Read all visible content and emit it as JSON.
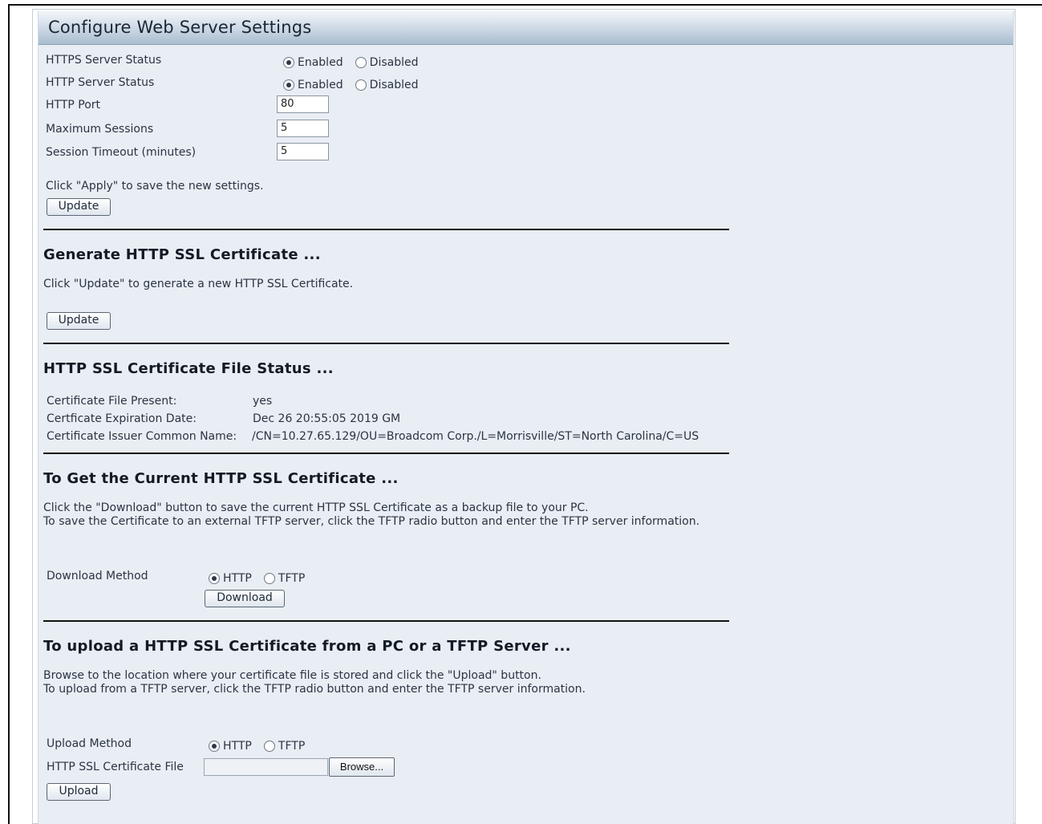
{
  "header": {
    "title": "Configure Web Server Settings"
  },
  "settings": {
    "https_label": "HTTPS Server Status",
    "http_label": "HTTP Server Status",
    "enabled": "Enabled",
    "disabled": "Disabled",
    "port_label": "HTTP Port",
    "port_value": "80",
    "max_sessions_label": "Maximum Sessions",
    "max_sessions_value": "5",
    "timeout_label": "Session Timeout (minutes)",
    "timeout_value": "5",
    "apply_note": "Click \"Apply\" to save the new settings.",
    "update_button": "Update"
  },
  "generate": {
    "heading": "Generate HTTP SSL Certificate ...",
    "note": "Click \"Update\" to generate a new HTTP SSL Certificate.",
    "update_button": "Update"
  },
  "status": {
    "heading": "HTTP SSL Certificate File Status ...",
    "present_label": "Certificate File Present:",
    "present_value": "yes",
    "expiration_label": "Certficate Expiration Date:",
    "expiration_value": "Dec 26 20:55:05 2019 GM",
    "issuer_label": "Certificate Issuer Common Name:",
    "issuer_value": "/CN=10.27.65.129/OU=Broadcom Corp./L=Morrisville/ST=North Carolina/C=US"
  },
  "download": {
    "heading": "To Get the Current HTTP SSL Certificate ...",
    "line1": "Click the \"Download\" button to save the current HTTP SSL Certificate as a backup file to your PC.",
    "line2": "To save the Certificate to an external TFTP server, click the TFTP radio button and enter the TFTP server information.",
    "method_label": "Download Method",
    "opt_http": "HTTP",
    "opt_tftp": "TFTP",
    "button": "Download"
  },
  "upload": {
    "heading": "To upload a HTTP SSL Certificate from a PC or a TFTP Server ...",
    "line1": "Browse to the location where your certificate file is stored and click the \"Upload\" button.",
    "line2": "To upload from a TFTP server, click the TFTP radio button and enter the TFTP server information.",
    "method_label": "Upload Method",
    "opt_http": "HTTP",
    "opt_tftp": "TFTP",
    "file_label": "HTTP SSL Certificate File",
    "browse_button": "Browse...",
    "button": "Upload"
  }
}
